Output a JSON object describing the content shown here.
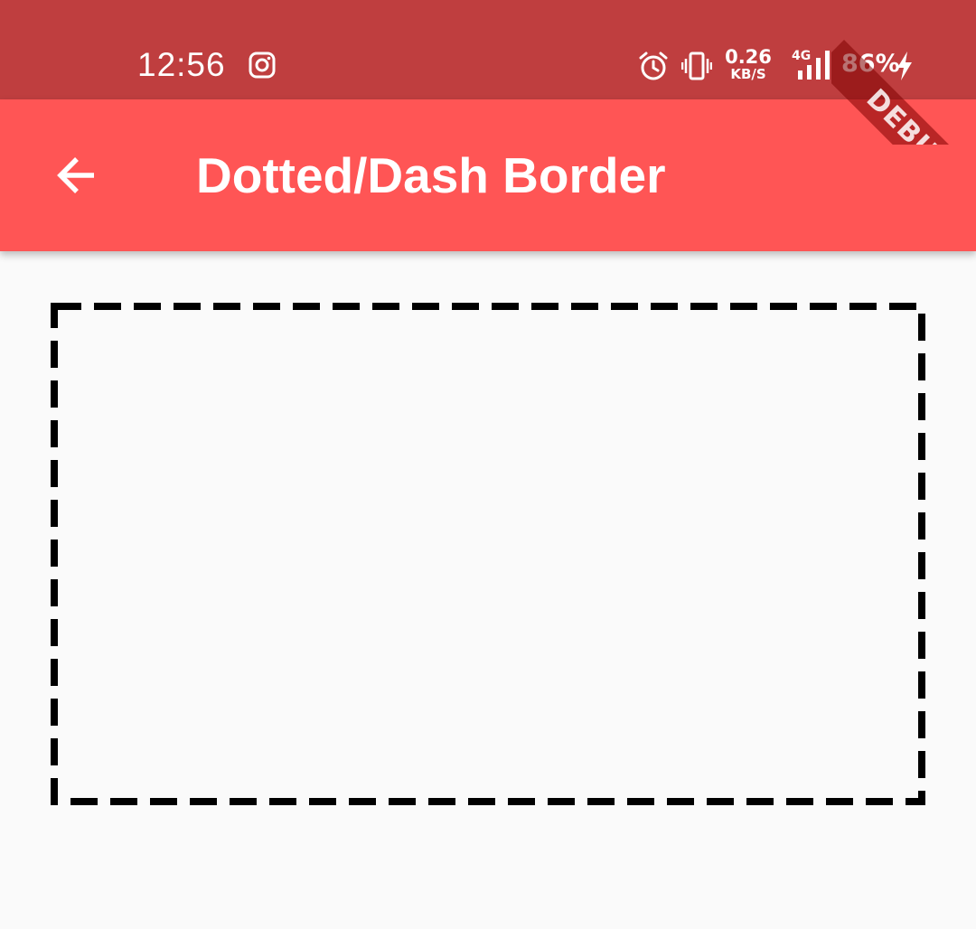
{
  "status_bar": {
    "time": "12:56",
    "net_speed_value": "0.26",
    "net_speed_unit": "KB/S",
    "network_type": "4G",
    "battery_percent": "86%",
    "icons": [
      "instagram-icon",
      "alarm-icon",
      "vibrate-icon",
      "signal-icon",
      "charging-bolt-icon"
    ]
  },
  "app_bar": {
    "title": "Dotted/Dash Border",
    "back_icon": "arrow-back-icon"
  },
  "debug_banner": {
    "label": "DEBUG"
  },
  "colors": {
    "status_bar": "#bf3e3f",
    "app_bar": "#ff5555",
    "background": "#fafafa",
    "border": "#000000"
  }
}
